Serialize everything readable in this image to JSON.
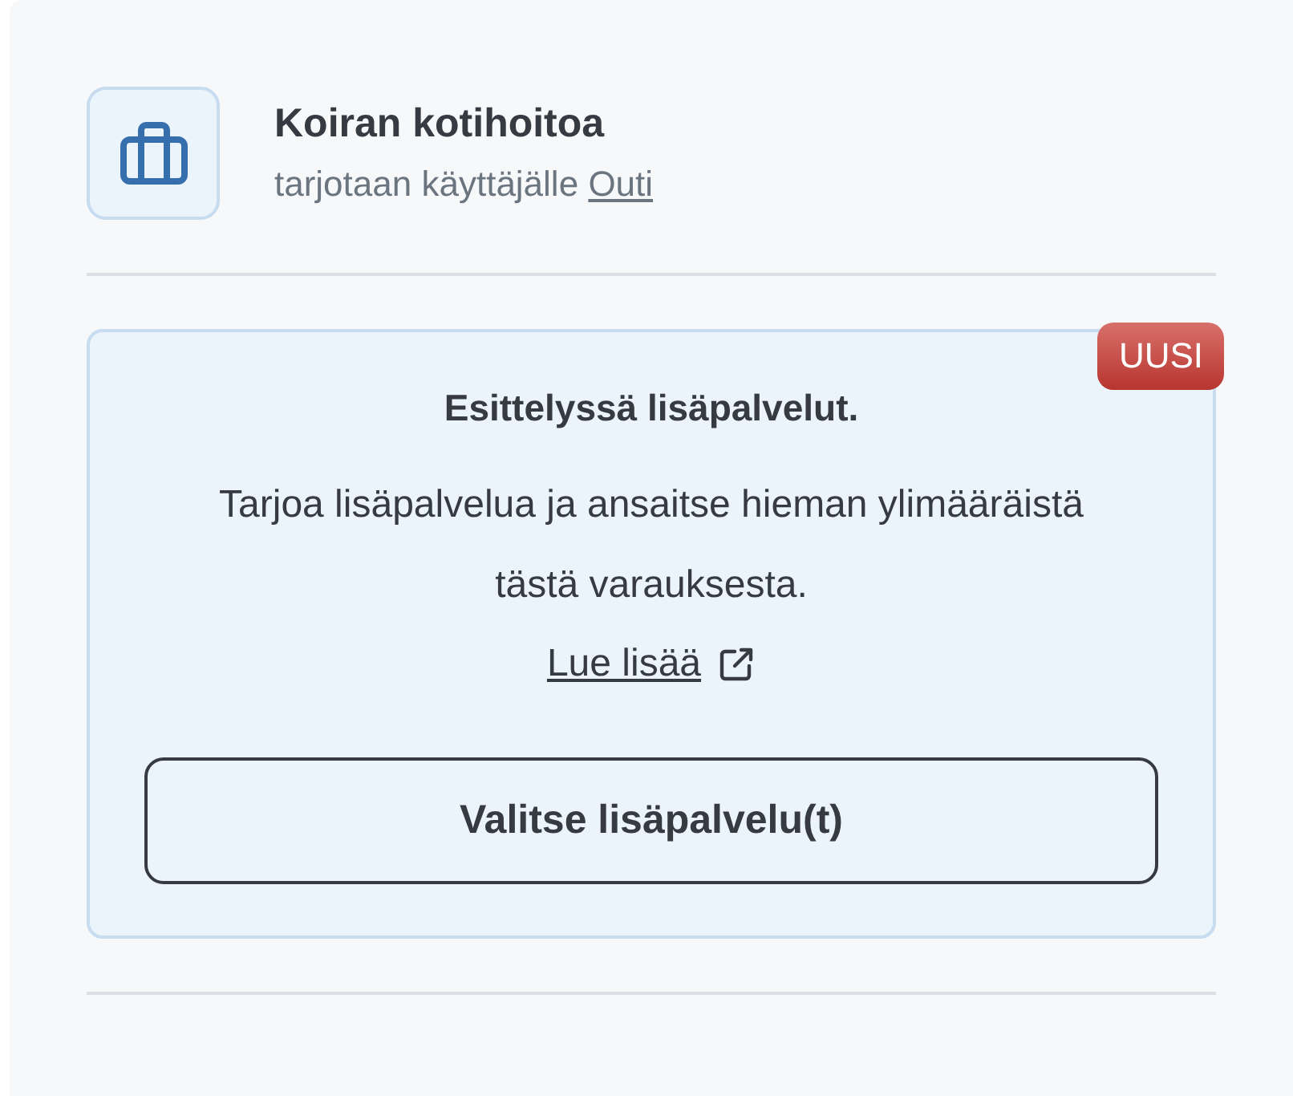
{
  "service": {
    "title": "Koiran kotihoitoa",
    "subtitle": "tarjotaan käyttäjälle",
    "user_link": "Outi"
  },
  "promo": {
    "badge": "UUSI",
    "heading": "Esittelyssä lisäpalvelut.",
    "text": "Tarjoa lisäpalvelua ja ansaitse hieman ylimääräistä tästä varauksesta.",
    "link": "Lue lisää",
    "button": "Valitse lisäpalvelu(t)"
  }
}
